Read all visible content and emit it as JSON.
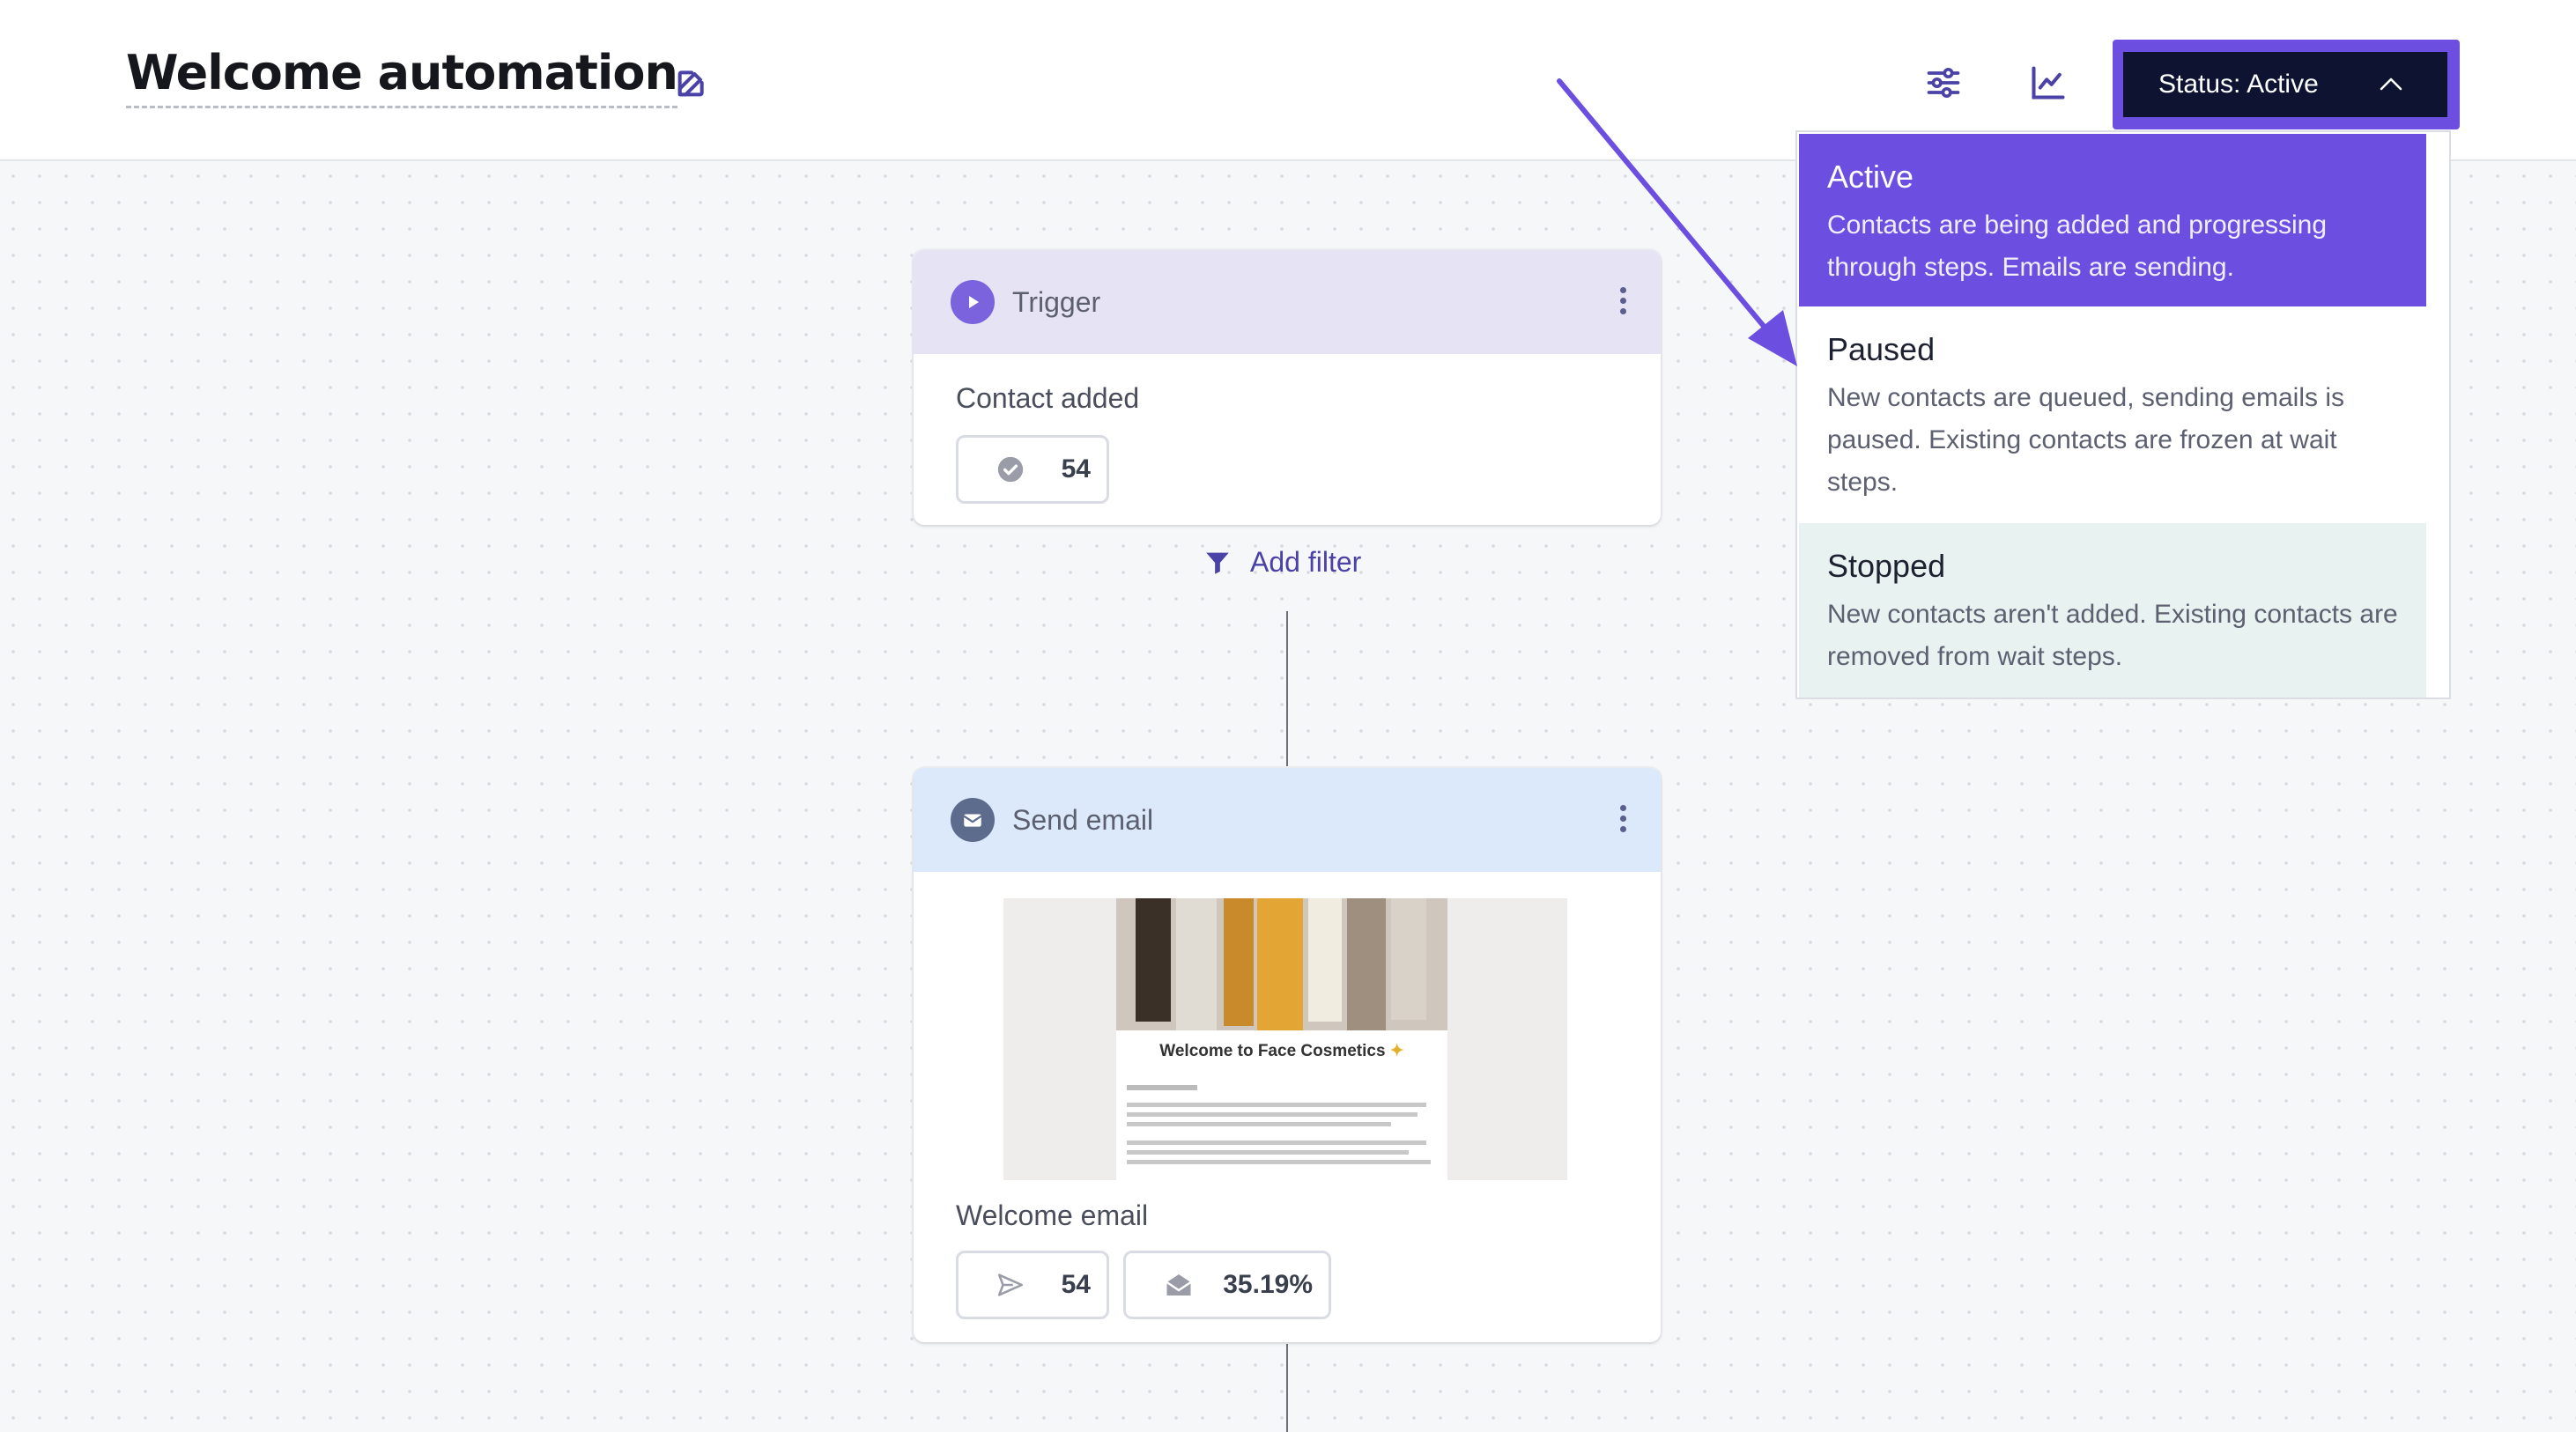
{
  "header": {
    "title": "Welcome automation",
    "edit_icon": "pencil-icon",
    "settings_icon": "sliders-icon",
    "analytics_icon": "line-chart-icon",
    "status_label": "Status: Active"
  },
  "status_menu": {
    "options": [
      {
        "title": "Active",
        "description": "Contacts are being added and progressing through steps. Emails are sending.",
        "selected": true
      },
      {
        "title": "Paused",
        "description": "New contacts are queued, sending emails is paused. Existing contacts are frozen at wait steps."
      },
      {
        "title": "Stopped",
        "description": "New contacts aren't added. Existing contacts are removed from wait steps."
      }
    ]
  },
  "trigger_card": {
    "label": "Trigger",
    "event": "Contact added",
    "count": "54"
  },
  "filter": {
    "label": "Add filter"
  },
  "email_card": {
    "label": "Send email",
    "thumbnail_heading": "Welcome to Face Cosmetics",
    "name": "Welcome email",
    "sent_count": "54",
    "open_rate": "35.19%"
  },
  "colors": {
    "accent": "#6c4ee0",
    "dark_button": "#0d1331",
    "trigger_header": "#e6e3f4",
    "email_header": "#dbe9fb",
    "stopped_bg": "#e8f3f1",
    "link": "#4a42a6"
  }
}
